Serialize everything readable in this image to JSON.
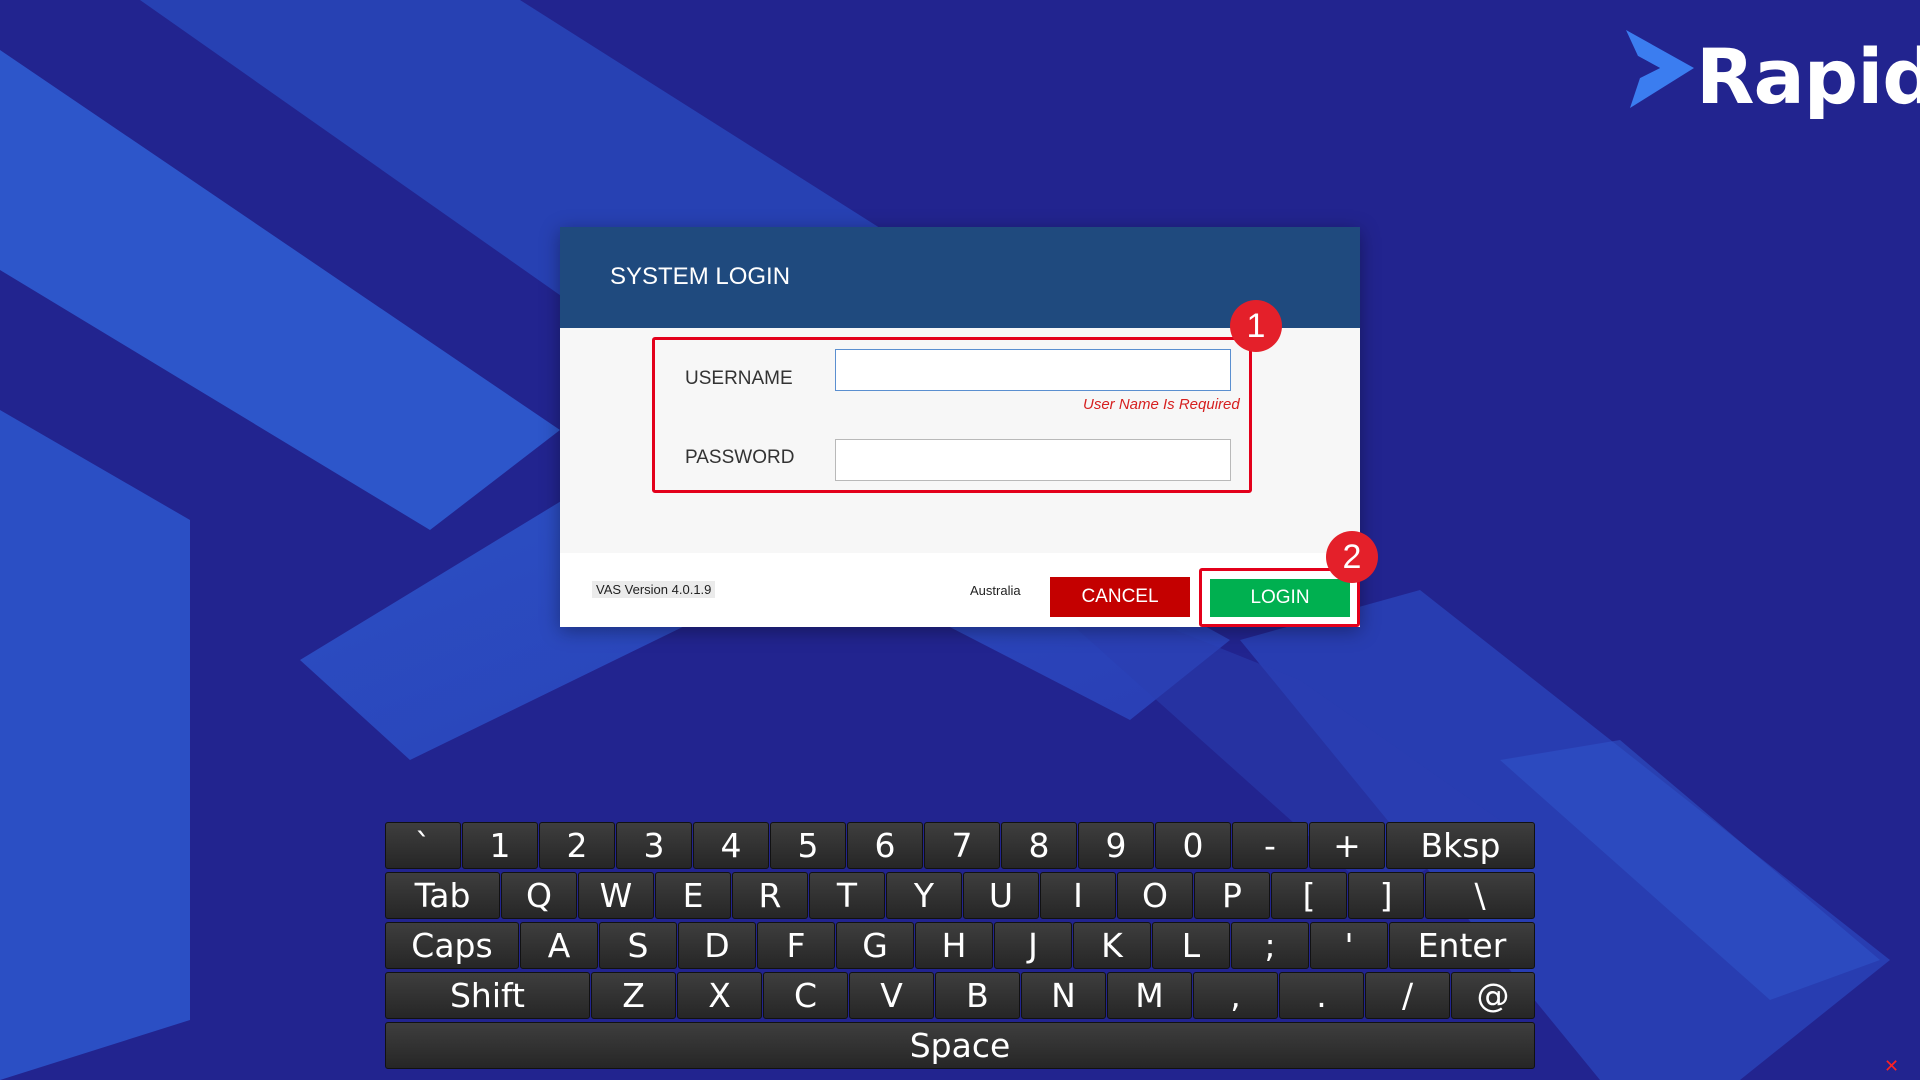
{
  "logo": {
    "text": "Rapid"
  },
  "dialog": {
    "title": "SYSTEM LOGIN",
    "username_label": "USERNAME",
    "username_value": "",
    "username_error": "User Name Is Required",
    "password_label": "PASSWORD",
    "password_value": "",
    "version": "VAS Version 4.0.1.9",
    "region": "Australia",
    "cancel_label": "CANCEL",
    "login_label": "LOGIN"
  },
  "annotations": {
    "badge1": "1",
    "badge2": "2"
  },
  "keyboard": {
    "rows": [
      [
        "`",
        "1",
        "2",
        "3",
        "4",
        "5",
        "6",
        "7",
        "8",
        "9",
        "0",
        "-",
        "+",
        "Bksp"
      ],
      [
        "Tab",
        "Q",
        "W",
        "E",
        "R",
        "T",
        "Y",
        "U",
        "I",
        "O",
        "P",
        "[",
        "]",
        "\\"
      ],
      [
        "Caps",
        "A",
        "S",
        "D",
        "F",
        "G",
        "H",
        "J",
        "K",
        "L",
        ";",
        "'",
        "Enter"
      ],
      [
        "Shift",
        "Z",
        "X",
        "C",
        "V",
        "B",
        "N",
        "M",
        ",",
        ".",
        "/",
        "@"
      ],
      [
        "Space"
      ]
    ]
  },
  "colors": {
    "background": "#22248f",
    "header": "#1f4a7e",
    "cancel": "#c40000",
    "login": "#00b050",
    "annotation": "#e3001b"
  }
}
